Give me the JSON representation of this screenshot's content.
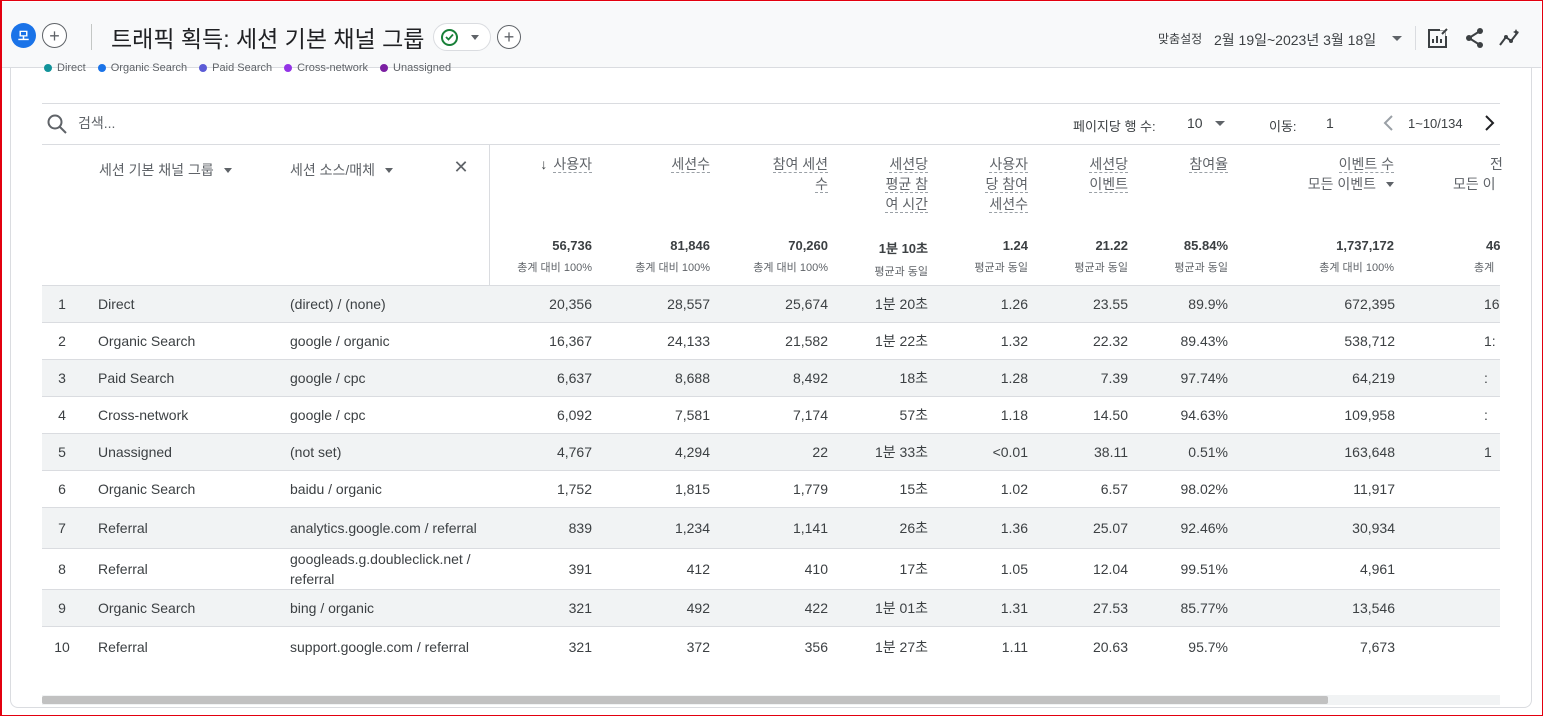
{
  "header": {
    "avatar_letter": "모",
    "title": "트래픽 획득: 세션 기본 채널 그룹",
    "custom_label": "맞춤설정",
    "date_range": "2월 19일~2023년 3월 18일"
  },
  "legend": [
    {
      "label": "Direct",
      "color": "#12939a"
    },
    {
      "label": "Organic Search",
      "color": "#1a73e8"
    },
    {
      "label": "Paid Search",
      "color": "#5b5bd6"
    },
    {
      "label": "Cross-network",
      "color": "#9334e6"
    },
    {
      "label": "Unassigned",
      "color": "#7b1fa2"
    }
  ],
  "toolbar": {
    "search_placeholder": "검색...",
    "rows_per_page_label": "페이지당 행 수:",
    "rows_per_page_value": "10",
    "goto_label": "이동:",
    "goto_value": "1",
    "range_text": "1~10/134"
  },
  "dimensions": {
    "primary": "세션 기본 채널 그룹",
    "secondary": "세션 소스/매체"
  },
  "metrics": [
    {
      "line1": "사용자",
      "sorted": true,
      "total": "56,736",
      "cmp": "총계 대비 100%"
    },
    {
      "line1": "세션수",
      "total": "81,846",
      "cmp": "총계 대비 100%"
    },
    {
      "line1": "참여 세션",
      "line2": "수",
      "total": "70,260",
      "cmp": "총계 대비 100%"
    },
    {
      "line1": "세션당",
      "line2": "평균 참",
      "line3": "여 시간",
      "total": "1분 10초",
      "cmp": "평균과 동일"
    },
    {
      "line1": "사용자",
      "line2": "당 참여",
      "line3": "세션수",
      "total": "1.24",
      "cmp": "평균과 동일"
    },
    {
      "line1": "세션당",
      "line2": "이벤트",
      "total": "21.22",
      "cmp": "평균과 동일"
    },
    {
      "line1": "참여율",
      "total": "85.84%",
      "cmp": "평균과 동일"
    },
    {
      "line1": "이벤트 수",
      "sub": "모든 이벤트",
      "total": "1,737,172",
      "cmp": "총계 대비 100%"
    },
    {
      "line1": "전",
      "sub": "모든 이",
      "total": "46",
      "cmp": "총계"
    }
  ],
  "rows": [
    {
      "idx": "1",
      "channel": "Direct",
      "source": "(direct) / (none)",
      "v": [
        "20,356",
        "28,557",
        "25,674",
        "1분 20초",
        "1.26",
        "23.55",
        "89.9%",
        "672,395",
        "16"
      ]
    },
    {
      "idx": "2",
      "channel": "Organic Search",
      "source": "google / organic",
      "v": [
        "16,367",
        "24,133",
        "21,582",
        "1분 22초",
        "1.32",
        "22.32",
        "89.43%",
        "538,712",
        "1:"
      ]
    },
    {
      "idx": "3",
      "channel": "Paid Search",
      "source": "google / cpc",
      "v": [
        "6,637",
        "8,688",
        "8,492",
        "18초",
        "1.28",
        "7.39",
        "97.74%",
        "64,219",
        ":"
      ]
    },
    {
      "idx": "4",
      "channel": "Cross-network",
      "source": "google / cpc",
      "v": [
        "6,092",
        "7,581",
        "7,174",
        "57초",
        "1.18",
        "14.50",
        "94.63%",
        "109,958",
        ":"
      ]
    },
    {
      "idx": "5",
      "channel": "Unassigned",
      "source": "(not set)",
      "v": [
        "4,767",
        "4,294",
        "22",
        "1분 33초",
        "<0.01",
        "38.11",
        "0.51%",
        "163,648",
        "1"
      ]
    },
    {
      "idx": "6",
      "channel": "Organic Search",
      "source": "baidu / organic",
      "v": [
        "1,752",
        "1,815",
        "1,779",
        "15초",
        "1.02",
        "6.57",
        "98.02%",
        "11,917",
        ""
      ]
    },
    {
      "idx": "7",
      "channel": "Referral",
      "source": "analytics.google.com / referral",
      "v": [
        "839",
        "1,234",
        "1,141",
        "26초",
        "1.36",
        "25.07",
        "92.46%",
        "30,934",
        ""
      ]
    },
    {
      "idx": "8",
      "channel": "Referral",
      "source": "googleads.g.doubleclick.net / referral",
      "v": [
        "391",
        "412",
        "410",
        "17초",
        "1.05",
        "12.04",
        "99.51%",
        "4,961",
        ""
      ]
    },
    {
      "idx": "9",
      "channel": "Organic Search",
      "source": "bing / organic",
      "v": [
        "321",
        "492",
        "422",
        "1분 01초",
        "1.31",
        "27.53",
        "85.77%",
        "13,546",
        ""
      ]
    },
    {
      "idx": "10",
      "channel": "Referral",
      "source": "support.google.com / referral",
      "v": [
        "321",
        "372",
        "356",
        "1분 27초",
        "1.11",
        "20.63",
        "95.7%",
        "7,673",
        ""
      ]
    }
  ]
}
